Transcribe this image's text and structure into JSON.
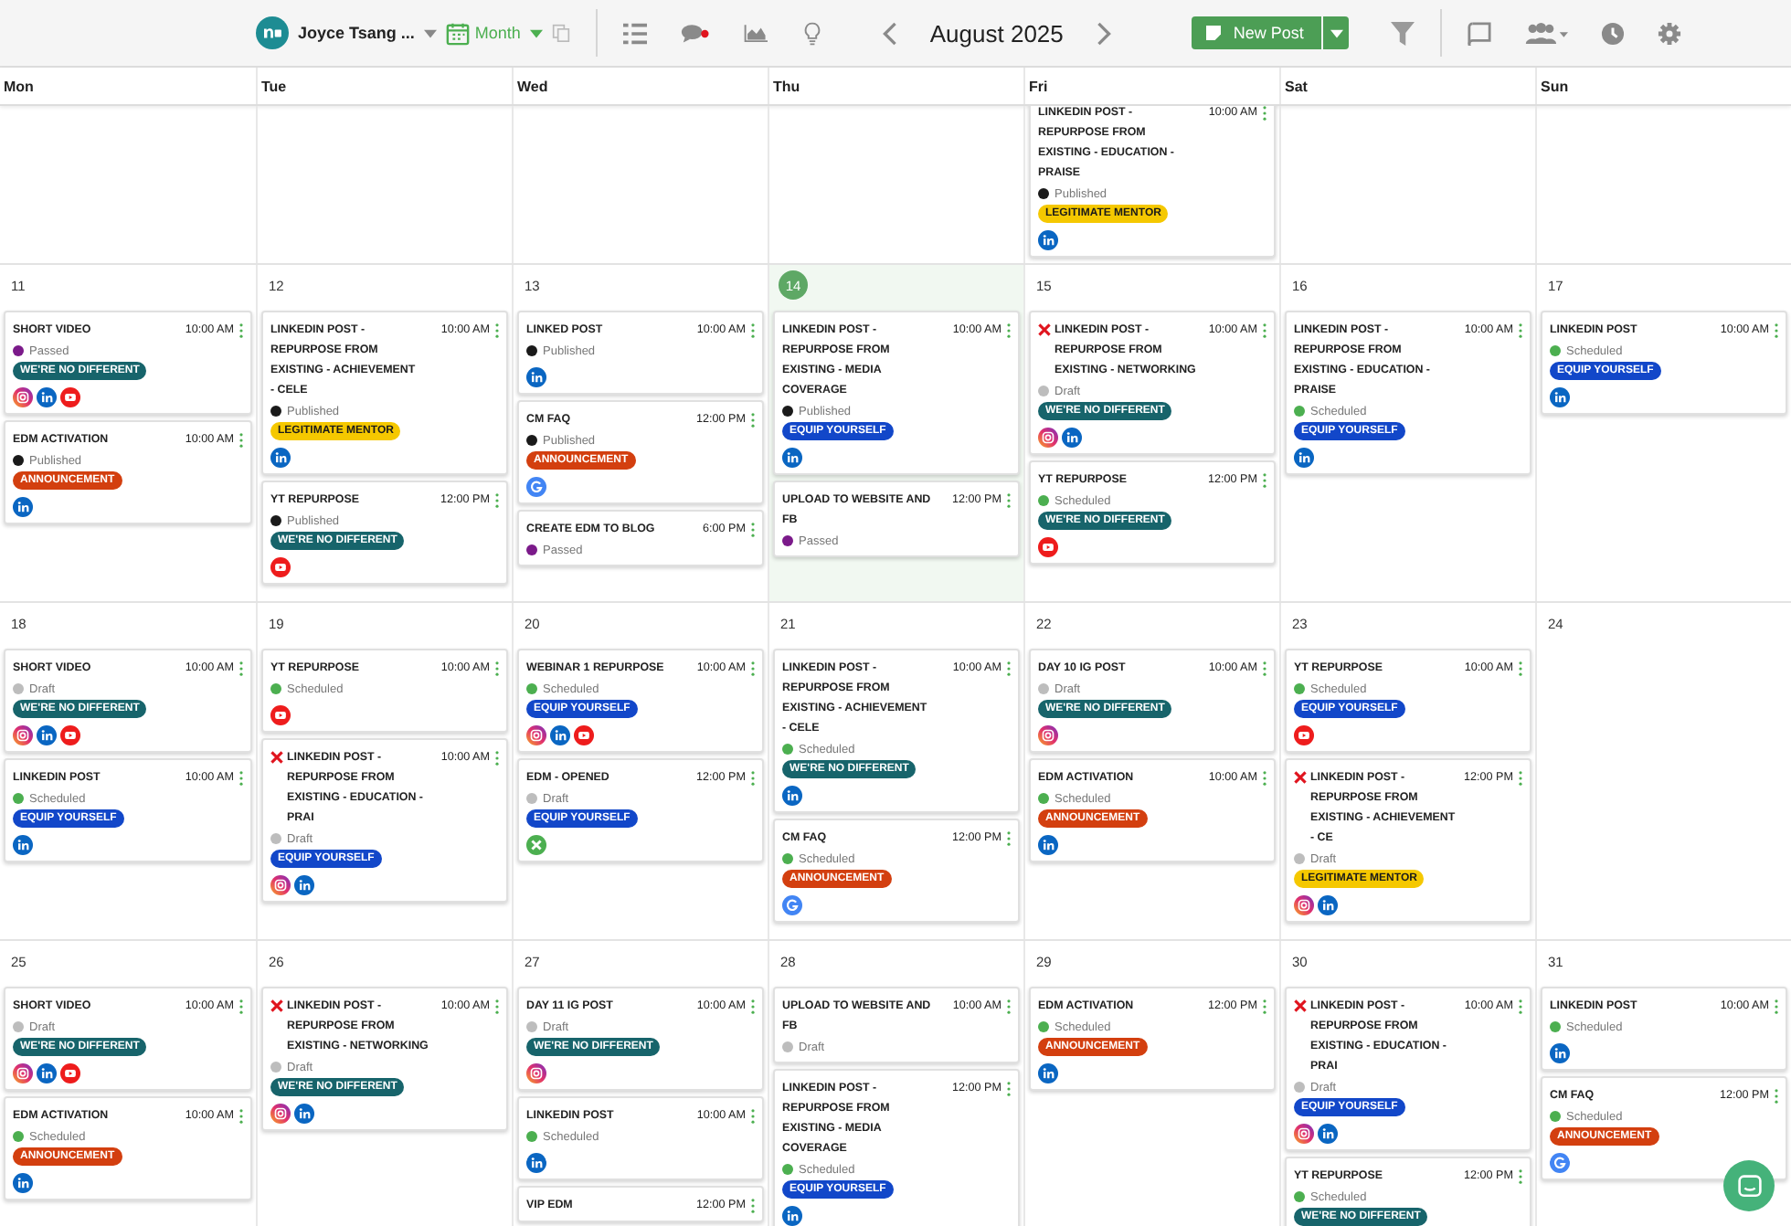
{
  "toolbar": {
    "account": "Joyce Tsang ...",
    "view": "Month",
    "month": "August 2025",
    "new_post": "New Post"
  },
  "weekdays": [
    "Mon",
    "Tue",
    "Wed",
    "Thu",
    "Fri",
    "Sat",
    "Sun"
  ],
  "weeks": [
    {
      "fri": {
        "posts": [
          {
            "title": "LINKEDIN POST - REPURPOSE FROM EXISTING - EDUCATION - PRAISE",
            "time": "10:00 AM",
            "failed": false,
            "status": {
              "label": "Published",
              "color": "#1a1a1a"
            },
            "tag": {
              "label": "LEGITIMATE MENTOR",
              "color": "#f5c800"
            },
            "channels": [
              {
                "kind": "linkedin"
              }
            ]
          }
        ]
      }
    },
    {
      "days": [
        {
          "date": "11",
          "today": false,
          "posts": [
            {
              "title": "SHORT VIDEO",
              "time": "10:00 AM",
              "failed": false,
              "status": {
                "label": "Passed",
                "color": "#7b1a8a"
              },
              "tag": {
                "label": "WE'RE NO DIFFERENT",
                "color": "#17646b"
              },
              "channels": [
                {
                  "kind": "instagram"
                },
                {
                  "kind": "linkedin"
                },
                {
                  "kind": "youtube"
                }
              ]
            },
            {
              "title": "EDM ACTIVATION",
              "time": "10:00 AM",
              "failed": false,
              "status": {
                "label": "Published",
                "color": "#1a1a1a"
              },
              "tag": {
                "label": "ANNOUNCEMENT",
                "color": "#d33f0f"
              },
              "channels": [
                {
                  "kind": "linkedin"
                }
              ]
            }
          ]
        },
        {
          "date": "12",
          "today": false,
          "posts": [
            {
              "title": "LINKEDIN POST - REPURPOSE FROM EXISTING - ACHIEVEMENT - CELE",
              "time": "10:00 AM",
              "failed": false,
              "status": {
                "label": "Published",
                "color": "#1a1a1a"
              },
              "tag": {
                "label": "LEGITIMATE MENTOR",
                "color": "#f5c800"
              },
              "channels": [
                {
                  "kind": "linkedin"
                }
              ]
            },
            {
              "title": "YT REPURPOSE",
              "time": "12:00 PM",
              "failed": false,
              "status": {
                "label": "Published",
                "color": "#1a1a1a"
              },
              "tag": {
                "label": "WE'RE NO DIFFERENT",
                "color": "#17646b"
              },
              "channels": [
                {
                  "kind": "youtube"
                }
              ]
            }
          ]
        },
        {
          "date": "13",
          "today": false,
          "posts": [
            {
              "title": "LINKED POST",
              "time": "10:00 AM",
              "failed": false,
              "status": {
                "label": "Published",
                "color": "#1a1a1a"
              },
              "channels": [
                {
                  "kind": "linkedin"
                }
              ]
            },
            {
              "title": "CM FAQ",
              "time": "12:00 PM",
              "failed": false,
              "status": {
                "label": "Published",
                "color": "#1a1a1a"
              },
              "tag": {
                "label": "ANNOUNCEMENT",
                "color": "#d33f0f"
              },
              "channels": [
                {
                  "kind": "google"
                }
              ]
            },
            {
              "title": "CREATE EDM TO BLOG",
              "time": "6:00 PM",
              "failed": false,
              "status": {
                "label": "Passed",
                "color": "#7b1a8a"
              }
            }
          ]
        },
        {
          "date": "14",
          "today": true,
          "posts": [
            {
              "title": "LINKEDIN POST - REPURPOSE FROM EXISTING - MEDIA COVERAGE",
              "time": "10:00 AM",
              "failed": false,
              "status": {
                "label": "Published",
                "color": "#1a1a1a"
              },
              "tag": {
                "label": "EQUIP YOURSELF",
                "color": "#1247c9"
              },
              "channels": [
                {
                  "kind": "linkedin"
                }
              ]
            },
            {
              "title": "UPLOAD TO WEBSITE AND FB",
              "time": "12:00 PM",
              "failed": false,
              "status": {
                "label": "Passed",
                "color": "#7b1a8a"
              }
            }
          ]
        },
        {
          "date": "15",
          "today": false,
          "posts": [
            {
              "title": "LINKEDIN POST - REPURPOSE FROM EXISTING - NETWORKING",
              "time": "10:00 AM",
              "failed": true,
              "status": {
                "label": "Draft",
                "color": "#bdbdbd"
              },
              "tag": {
                "label": "WE'RE NO DIFFERENT",
                "color": "#17646b"
              },
              "channels": [
                {
                  "kind": "instagram"
                },
                {
                  "kind": "linkedin"
                }
              ]
            },
            {
              "title": "YT REPURPOSE",
              "time": "12:00 PM",
              "failed": false,
              "status": {
                "label": "Scheduled",
                "color": "#4caf50"
              },
              "tag": {
                "label": "WE'RE NO DIFFERENT",
                "color": "#17646b"
              },
              "channels": [
                {
                  "kind": "youtube"
                }
              ]
            }
          ]
        },
        {
          "date": "16",
          "today": false,
          "posts": [
            {
              "title": "LINKEDIN POST - REPURPOSE FROM EXISTING - EDUCATION - PRAISE",
              "time": "10:00 AM",
              "failed": false,
              "status": {
                "label": "Scheduled",
                "color": "#4caf50"
              },
              "tag": {
                "label": "EQUIP YOURSELF",
                "color": "#1247c9"
              },
              "channels": [
                {
                  "kind": "linkedin"
                }
              ]
            }
          ]
        },
        {
          "date": "17",
          "today": false,
          "posts": [
            {
              "title": "LINKEDIN POST",
              "time": "10:00 AM",
              "failed": false,
              "status": {
                "label": "Scheduled",
                "color": "#4caf50"
              },
              "tag": {
                "label": "EQUIP YOURSELF",
                "color": "#1247c9"
              },
              "channels": [
                {
                  "kind": "linkedin"
                }
              ]
            }
          ]
        }
      ]
    },
    {
      "days": [
        {
          "date": "18",
          "today": false,
          "posts": [
            {
              "title": "SHORT VIDEO",
              "time": "10:00 AM",
              "failed": false,
              "status": {
                "label": "Draft",
                "color": "#bdbdbd"
              },
              "tag": {
                "label": "WE'RE NO DIFFERENT",
                "color": "#17646b"
              },
              "channels": [
                {
                  "kind": "instagram"
                },
                {
                  "kind": "linkedin"
                },
                {
                  "kind": "youtube"
                }
              ]
            },
            {
              "title": "LINKEDIN POST",
              "time": "10:00 AM",
              "failed": false,
              "status": {
                "label": "Scheduled",
                "color": "#4caf50"
              },
              "tag": {
                "label": "EQUIP YOURSELF",
                "color": "#1247c9"
              },
              "channels": [
                {
                  "kind": "linkedin"
                }
              ]
            }
          ]
        },
        {
          "date": "19",
          "today": false,
          "posts": [
            {
              "title": "YT REPURPOSE",
              "time": "10:00 AM",
              "failed": false,
              "status": {
                "label": "Scheduled",
                "color": "#4caf50"
              },
              "channels": [
                {
                  "kind": "youtube"
                }
              ]
            },
            {
              "title": "LINKEDIN POST - REPURPOSE FROM EXISTING - EDUCATION - PRAI",
              "time": "10:00 AM",
              "failed": true,
              "status": {
                "label": "Draft",
                "color": "#bdbdbd"
              },
              "tag": {
                "label": "EQUIP YOURSELF",
                "color": "#1247c9"
              },
              "channels": [
                {
                  "kind": "instagram"
                },
                {
                  "kind": "linkedin"
                }
              ]
            }
          ]
        },
        {
          "date": "20",
          "today": false,
          "posts": [
            {
              "title": "WEBINAR 1 REPURPOSE",
              "time": "10:00 AM",
              "failed": false,
              "status": {
                "label": "Scheduled",
                "color": "#4caf50"
              },
              "tag": {
                "label": "EQUIP YOURSELF",
                "color": "#1247c9"
              },
              "channels": [
                {
                  "kind": "instagram"
                },
                {
                  "kind": "linkedin"
                },
                {
                  "kind": "youtube"
                }
              ]
            },
            {
              "title": "EDM - OPENED",
              "time": "12:00 PM",
              "failed": false,
              "status": {
                "label": "Draft",
                "color": "#bdbdbd"
              },
              "tag": {
                "label": "EQUIP YOURSELF",
                "color": "#1247c9"
              },
              "channels": [
                {
                  "kind": "other"
                }
              ]
            }
          ]
        },
        {
          "date": "21",
          "today": false,
          "posts": [
            {
              "title": "LINKEDIN POST - REPURPOSE FROM EXISTING - ACHIEVEMENT - CELE",
              "time": "10:00 AM",
              "failed": false,
              "status": {
                "label": "Scheduled",
                "color": "#4caf50"
              },
              "tag": {
                "label": "WE'RE NO DIFFERENT",
                "color": "#17646b"
              },
              "channels": [
                {
                  "kind": "linkedin"
                }
              ]
            },
            {
              "title": "CM FAQ",
              "time": "12:00 PM",
              "failed": false,
              "status": {
                "label": "Scheduled",
                "color": "#4caf50"
              },
              "tag": {
                "label": "ANNOUNCEMENT",
                "color": "#d33f0f"
              },
              "channels": [
                {
                  "kind": "google"
                }
              ]
            }
          ]
        },
        {
          "date": "22",
          "today": false,
          "posts": [
            {
              "title": "DAY 10 IG POST",
              "time": "10:00 AM",
              "failed": false,
              "status": {
                "label": "Draft",
                "color": "#bdbdbd"
              },
              "tag": {
                "label": "WE'RE NO DIFFERENT",
                "color": "#17646b"
              },
              "channels": [
                {
                  "kind": "instagram"
                }
              ]
            },
            {
              "title": "EDM ACTIVATION",
              "time": "10:00 AM",
              "failed": false,
              "status": {
                "label": "Scheduled",
                "color": "#4caf50"
              },
              "tag": {
                "label": "ANNOUNCEMENT",
                "color": "#d33f0f"
              },
              "channels": [
                {
                  "kind": "linkedin"
                }
              ]
            }
          ]
        },
        {
          "date": "23",
          "today": false,
          "posts": [
            {
              "title": "YT REPURPOSE",
              "time": "10:00 AM",
              "failed": false,
              "status": {
                "label": "Scheduled",
                "color": "#4caf50"
              },
              "tag": {
                "label": "EQUIP YOURSELF",
                "color": "#1247c9"
              },
              "channels": [
                {
                  "kind": "youtube"
                }
              ]
            },
            {
              "title": "LINKEDIN POST - REPURPOSE FROM EXISTING - ACHIEVEMENT - CE",
              "time": "12:00 PM",
              "failed": true,
              "status": {
                "label": "Draft",
                "color": "#bdbdbd"
              },
              "tag": {
                "label": "LEGITIMATE MENTOR",
                "color": "#f5c800"
              },
              "channels": [
                {
                  "kind": "instagram"
                },
                {
                  "kind": "linkedin"
                }
              ]
            }
          ]
        },
        {
          "date": "24",
          "today": false
        }
      ]
    },
    {
      "days": [
        {
          "date": "25",
          "today": false,
          "posts": [
            {
              "title": "SHORT VIDEO",
              "time": "10:00 AM",
              "failed": false,
              "status": {
                "label": "Draft",
                "color": "#bdbdbd"
              },
              "tag": {
                "label": "WE'RE NO DIFFERENT",
                "color": "#17646b"
              },
              "channels": [
                {
                  "kind": "instagram"
                },
                {
                  "kind": "linkedin"
                },
                {
                  "kind": "youtube"
                }
              ]
            },
            {
              "title": "EDM ACTIVATION",
              "time": "10:00 AM",
              "failed": false,
              "status": {
                "label": "Scheduled",
                "color": "#4caf50"
              },
              "tag": {
                "label": "ANNOUNCEMENT",
                "color": "#d33f0f"
              },
              "channels": [
                {
                  "kind": "linkedin"
                }
              ]
            }
          ]
        },
        {
          "date": "26",
          "today": false,
          "posts": [
            {
              "title": "LINKEDIN POST - REPURPOSE FROM EXISTING - NETWORKING",
              "time": "10:00 AM",
              "failed": true,
              "status": {
                "label": "Draft",
                "color": "#bdbdbd"
              },
              "tag": {
                "label": "WE'RE NO DIFFERENT",
                "color": "#17646b"
              },
              "channels": [
                {
                  "kind": "instagram"
                },
                {
                  "kind": "linkedin"
                }
              ]
            }
          ]
        },
        {
          "date": "27",
          "today": false,
          "posts": [
            {
              "title": "DAY 11 IG POST",
              "time": "10:00 AM",
              "failed": false,
              "status": {
                "label": "Draft",
                "color": "#bdbdbd"
              },
              "tag": {
                "label": "WE'RE NO DIFFERENT",
                "color": "#17646b"
              },
              "channels": [
                {
                  "kind": "instagram"
                }
              ]
            },
            {
              "title": "LINKEDIN POST",
              "time": "10:00 AM",
              "failed": false,
              "status": {
                "label": "Scheduled",
                "color": "#4caf50"
              },
              "channels": [
                {
                  "kind": "linkedin"
                }
              ]
            },
            {
              "title": "VIP EDM",
              "time": "12:00 PM",
              "failed": false
            }
          ]
        },
        {
          "date": "28",
          "today": false,
          "posts": [
            {
              "title": "UPLOAD TO WEBSITE AND FB",
              "time": "10:00 AM",
              "failed": false,
              "status": {
                "label": "Draft",
                "color": "#bdbdbd"
              }
            },
            {
              "title": "LINKEDIN POST - REPURPOSE FROM EXISTING - MEDIA COVERAGE",
              "time": "12:00 PM",
              "failed": false,
              "status": {
                "label": "Scheduled",
                "color": "#4caf50"
              },
              "tag": {
                "label": "EQUIP YOURSELF",
                "color": "#1247c9"
              },
              "channels": [
                {
                  "kind": "linkedin"
                }
              ]
            }
          ]
        },
        {
          "date": "29",
          "today": false,
          "posts": [
            {
              "title": "EDM ACTIVATION",
              "time": "12:00 PM",
              "failed": false,
              "status": {
                "label": "Scheduled",
                "color": "#4caf50"
              },
              "tag": {
                "label": "ANNOUNCEMENT",
                "color": "#d33f0f"
              },
              "channels": [
                {
                  "kind": "linkedin"
                }
              ]
            }
          ]
        },
        {
          "date": "30",
          "today": false,
          "posts": [
            {
              "title": "LINKEDIN POST - REPURPOSE FROM EXISTING - EDUCATION - PRAI",
              "time": "10:00 AM",
              "failed": true,
              "status": {
                "label": "Draft",
                "color": "#bdbdbd"
              },
              "tag": {
                "label": "EQUIP YOURSELF",
                "color": "#1247c9"
              },
              "channels": [
                {
                  "kind": "instagram"
                },
                {
                  "kind": "linkedin"
                }
              ]
            },
            {
              "title": "YT REPURPOSE",
              "time": "12:00 PM",
              "failed": false,
              "status": {
                "label": "Scheduled",
                "color": "#4caf50"
              },
              "tag": {
                "label": "WE'RE NO DIFFERENT",
                "color": "#17646b"
              }
            }
          ]
        },
        {
          "date": "31",
          "today": false,
          "posts": [
            {
              "title": "LINKEDIN POST",
              "time": "10:00 AM",
              "failed": false,
              "status": {
                "label": "Scheduled",
                "color": "#4caf50"
              },
              "channels": [
                {
                  "kind": "linkedin"
                }
              ]
            },
            {
              "title": "CM FAQ",
              "time": "12:00 PM",
              "failed": false,
              "status": {
                "label": "Scheduled",
                "color": "#4caf50"
              },
              "tag": {
                "label": "ANNOUNCEMENT",
                "color": "#d33f0f"
              },
              "channels": [
                {
                  "kind": "google"
                }
              ]
            }
          ]
        }
      ]
    }
  ]
}
